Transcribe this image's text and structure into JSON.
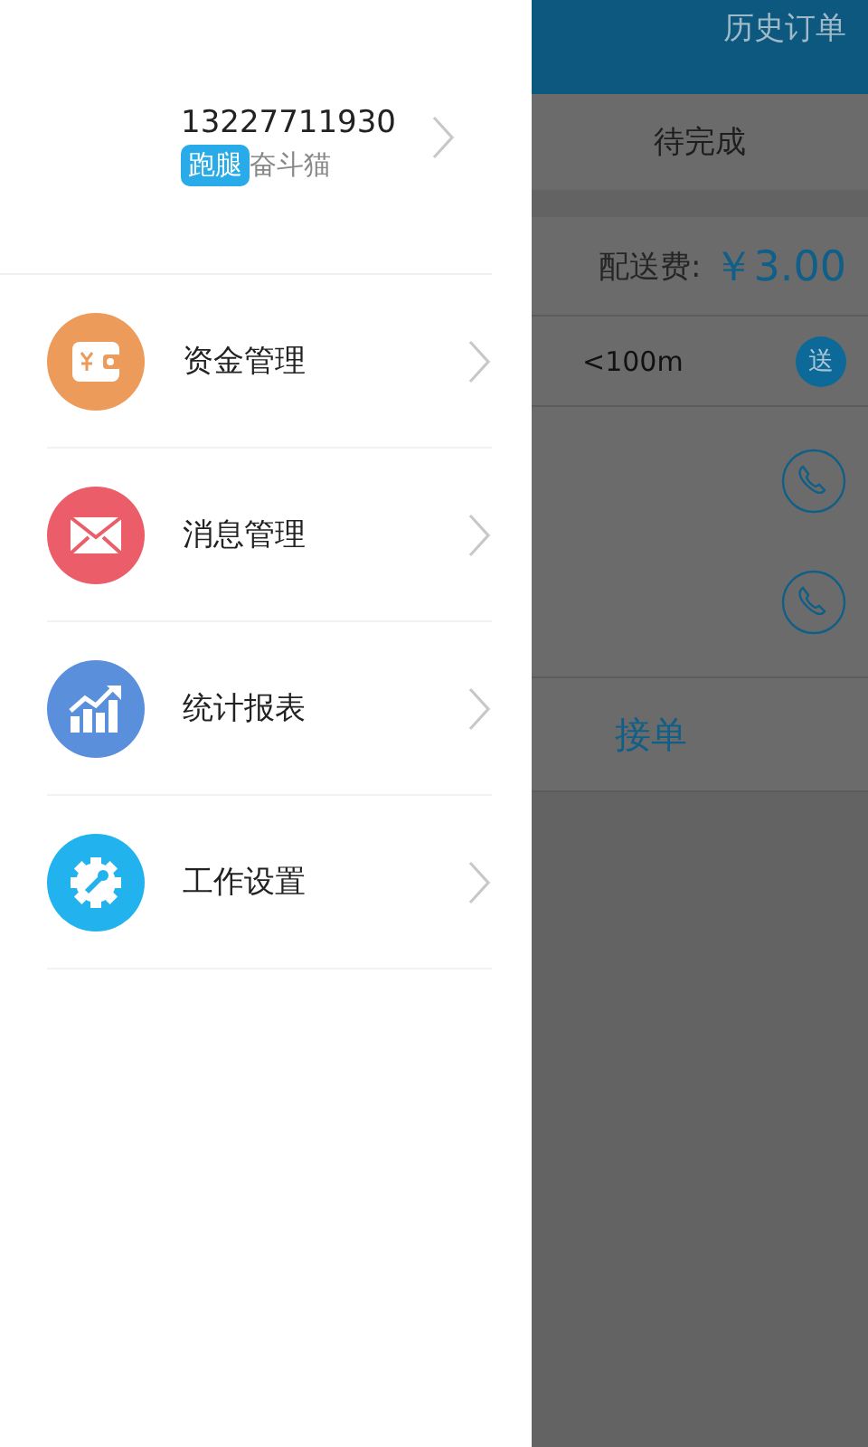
{
  "drawer": {
    "profile": {
      "phone": "13227711930",
      "badge": "跑腿",
      "name": "奋斗猫"
    },
    "menu": [
      {
        "label": "资金管理",
        "kind": "wallet",
        "color": "#ec9b5a"
      },
      {
        "label": "消息管理",
        "kind": "mail",
        "color": "#ec5d6a"
      },
      {
        "label": "统计报表",
        "kind": "chart",
        "color": "#5a8fdc"
      },
      {
        "label": "工作设置",
        "kind": "settings",
        "color": "#22b3ee"
      }
    ]
  },
  "background": {
    "header_title": "历史订单",
    "tab": "待完成",
    "fee_label": "配送费:",
    "fee_value": "￥3.00",
    "distance": "<100m",
    "delivery_badge": "送",
    "action": "接单"
  }
}
